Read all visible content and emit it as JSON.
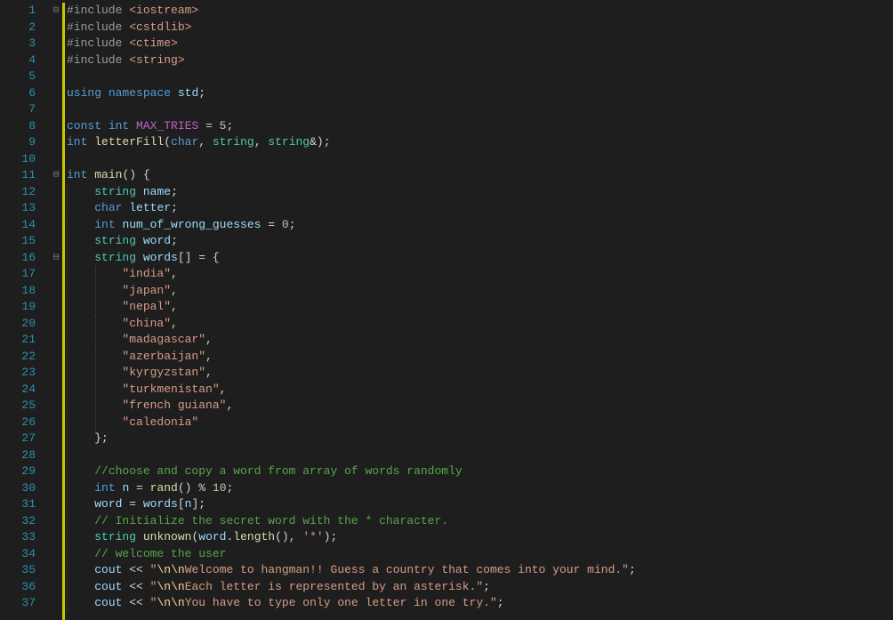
{
  "lines": [
    {
      "n": 1,
      "fold": "minus",
      "tokens": [
        [
          "preproc",
          "#include "
        ],
        [
          "string",
          "<iostream>"
        ]
      ]
    },
    {
      "n": 2,
      "fold": "",
      "tokens": [
        [
          "preproc",
          "#include "
        ],
        [
          "string",
          "<cstdlib>"
        ]
      ]
    },
    {
      "n": 3,
      "fold": "",
      "tokens": [
        [
          "preproc",
          "#include "
        ],
        [
          "string",
          "<ctime>"
        ]
      ]
    },
    {
      "n": 4,
      "fold": "",
      "tokens": [
        [
          "preproc",
          "#include "
        ],
        [
          "string",
          "<string>"
        ]
      ]
    },
    {
      "n": 5,
      "fold": "",
      "tokens": []
    },
    {
      "n": 6,
      "fold": "",
      "tokens": [
        [
          "keyword",
          "using"
        ],
        [
          "plain",
          " "
        ],
        [
          "keyword",
          "namespace"
        ],
        [
          "plain",
          " "
        ],
        [
          "var",
          "std"
        ],
        [
          "plain",
          ";"
        ]
      ]
    },
    {
      "n": 7,
      "fold": "",
      "tokens": []
    },
    {
      "n": 8,
      "fold": "",
      "tokens": [
        [
          "keyword",
          "const"
        ],
        [
          "plain",
          " "
        ],
        [
          "type",
          "int"
        ],
        [
          "plain",
          " "
        ],
        [
          "macro",
          "MAX_TRIES"
        ],
        [
          "plain",
          " = "
        ],
        [
          "num",
          "5"
        ],
        [
          "plain",
          ";"
        ]
      ]
    },
    {
      "n": 9,
      "fold": "",
      "tokens": [
        [
          "type",
          "int"
        ],
        [
          "plain",
          " "
        ],
        [
          "ident",
          "letterFill"
        ],
        [
          "plain",
          "("
        ],
        [
          "type",
          "char"
        ],
        [
          "plain",
          ", "
        ],
        [
          "class",
          "string"
        ],
        [
          "plain",
          ", "
        ],
        [
          "class",
          "string"
        ],
        [
          "plain",
          "&);"
        ]
      ]
    },
    {
      "n": 10,
      "fold": "",
      "tokens": []
    },
    {
      "n": 11,
      "fold": "minus",
      "tokens": [
        [
          "type",
          "int"
        ],
        [
          "plain",
          " "
        ],
        [
          "ident",
          "main"
        ],
        [
          "plain",
          "() {"
        ]
      ]
    },
    {
      "n": 12,
      "fold": "",
      "indent": 1,
      "tokens": [
        [
          "plain",
          "    "
        ],
        [
          "class",
          "string"
        ],
        [
          "plain",
          " "
        ],
        [
          "var",
          "name"
        ],
        [
          "plain",
          ";"
        ]
      ]
    },
    {
      "n": 13,
      "fold": "",
      "indent": 1,
      "tokens": [
        [
          "plain",
          "    "
        ],
        [
          "type",
          "char"
        ],
        [
          "plain",
          " "
        ],
        [
          "var",
          "letter"
        ],
        [
          "plain",
          ";"
        ]
      ]
    },
    {
      "n": 14,
      "fold": "",
      "indent": 1,
      "tokens": [
        [
          "plain",
          "    "
        ],
        [
          "type",
          "int"
        ],
        [
          "plain",
          " "
        ],
        [
          "var",
          "num_of_wrong_guesses"
        ],
        [
          "plain",
          " = "
        ],
        [
          "num",
          "0"
        ],
        [
          "plain",
          ";"
        ]
      ]
    },
    {
      "n": 15,
      "fold": "",
      "indent": 1,
      "tokens": [
        [
          "plain",
          "    "
        ],
        [
          "class",
          "string"
        ],
        [
          "plain",
          " "
        ],
        [
          "var",
          "word"
        ],
        [
          "plain",
          ";"
        ]
      ]
    },
    {
      "n": 16,
      "fold": "minus",
      "indent": 1,
      "tokens": [
        [
          "plain",
          "    "
        ],
        [
          "class",
          "string"
        ],
        [
          "plain",
          " "
        ],
        [
          "var",
          "words"
        ],
        [
          "plain",
          "[] = {"
        ]
      ]
    },
    {
      "n": 17,
      "fold": "",
      "indent": 2,
      "tokens": [
        [
          "plain",
          "        "
        ],
        [
          "string",
          "\"india\""
        ],
        [
          "plain",
          ","
        ]
      ]
    },
    {
      "n": 18,
      "fold": "",
      "indent": 2,
      "tokens": [
        [
          "plain",
          "        "
        ],
        [
          "string",
          "\"japan\""
        ],
        [
          "plain",
          ","
        ]
      ]
    },
    {
      "n": 19,
      "fold": "",
      "indent": 2,
      "tokens": [
        [
          "plain",
          "        "
        ],
        [
          "string",
          "\"nepal\""
        ],
        [
          "plain",
          ","
        ]
      ]
    },
    {
      "n": 20,
      "fold": "",
      "indent": 2,
      "tokens": [
        [
          "plain",
          "        "
        ],
        [
          "string",
          "\"china\""
        ],
        [
          "plain",
          ","
        ]
      ]
    },
    {
      "n": 21,
      "fold": "",
      "indent": 2,
      "tokens": [
        [
          "plain",
          "        "
        ],
        [
          "string",
          "\"madagascar\""
        ],
        [
          "plain",
          ","
        ]
      ]
    },
    {
      "n": 22,
      "fold": "",
      "indent": 2,
      "tokens": [
        [
          "plain",
          "        "
        ],
        [
          "string",
          "\"azerbaijan\""
        ],
        [
          "plain",
          ","
        ]
      ]
    },
    {
      "n": 23,
      "fold": "",
      "indent": 2,
      "tokens": [
        [
          "plain",
          "        "
        ],
        [
          "string",
          "\"kyrgyzstan\""
        ],
        [
          "plain",
          ","
        ]
      ]
    },
    {
      "n": 24,
      "fold": "",
      "indent": 2,
      "tokens": [
        [
          "plain",
          "        "
        ],
        [
          "string",
          "\"turkmenistan\""
        ],
        [
          "plain",
          ","
        ]
      ]
    },
    {
      "n": 25,
      "fold": "",
      "indent": 2,
      "tokens": [
        [
          "plain",
          "        "
        ],
        [
          "string",
          "\"french guiana\""
        ],
        [
          "plain",
          ","
        ]
      ]
    },
    {
      "n": 26,
      "fold": "",
      "indent": 2,
      "tokens": [
        [
          "plain",
          "        "
        ],
        [
          "string",
          "\"caledonia\""
        ]
      ]
    },
    {
      "n": 27,
      "fold": "",
      "indent": 1,
      "tokens": [
        [
          "plain",
          "    };"
        ]
      ]
    },
    {
      "n": 28,
      "fold": "",
      "indent": 1,
      "tokens": []
    },
    {
      "n": 29,
      "fold": "",
      "indent": 1,
      "tokens": [
        [
          "plain",
          "    "
        ],
        [
          "comment",
          "//choose and copy a word from array of words randomly"
        ]
      ]
    },
    {
      "n": 30,
      "fold": "",
      "indent": 1,
      "tokens": [
        [
          "plain",
          "    "
        ],
        [
          "type",
          "int"
        ],
        [
          "plain",
          " "
        ],
        [
          "var",
          "n"
        ],
        [
          "plain",
          " = "
        ],
        [
          "ident",
          "rand"
        ],
        [
          "plain",
          "() % "
        ],
        [
          "num",
          "10"
        ],
        [
          "plain",
          ";"
        ]
      ]
    },
    {
      "n": 31,
      "fold": "",
      "indent": 1,
      "tokens": [
        [
          "plain",
          "    "
        ],
        [
          "var",
          "word"
        ],
        [
          "plain",
          " = "
        ],
        [
          "var",
          "words"
        ],
        [
          "plain",
          "["
        ],
        [
          "var",
          "n"
        ],
        [
          "plain",
          "];"
        ]
      ]
    },
    {
      "n": 32,
      "fold": "",
      "indent": 1,
      "tokens": [
        [
          "plain",
          "    "
        ],
        [
          "comment",
          "// Initialize the secret word with the * character."
        ]
      ]
    },
    {
      "n": 33,
      "fold": "",
      "indent": 1,
      "tokens": [
        [
          "plain",
          "    "
        ],
        [
          "class",
          "string"
        ],
        [
          "plain",
          " "
        ],
        [
          "ident",
          "unknown"
        ],
        [
          "plain",
          "("
        ],
        [
          "var",
          "word"
        ],
        [
          "plain",
          "."
        ],
        [
          "ident",
          "length"
        ],
        [
          "plain",
          "(), "
        ],
        [
          "string",
          "'*'"
        ],
        [
          "plain",
          ");"
        ]
      ]
    },
    {
      "n": 34,
      "fold": "",
      "indent": 1,
      "tokens": [
        [
          "plain",
          "    "
        ],
        [
          "comment",
          "// welcome the user"
        ]
      ]
    },
    {
      "n": 35,
      "fold": "",
      "indent": 1,
      "tokens": [
        [
          "plain",
          "    "
        ],
        [
          "var",
          "cout"
        ],
        [
          "plain",
          " << "
        ],
        [
          "string",
          "\""
        ],
        [
          "esc",
          "\\n\\n"
        ],
        [
          "string",
          "Welcome to hangman!! Guess a country that comes into your mind.\""
        ],
        [
          "plain",
          ";"
        ]
      ]
    },
    {
      "n": 36,
      "fold": "",
      "indent": 1,
      "tokens": [
        [
          "plain",
          "    "
        ],
        [
          "var",
          "cout"
        ],
        [
          "plain",
          " << "
        ],
        [
          "string",
          "\""
        ],
        [
          "esc",
          "\\n\\n"
        ],
        [
          "string",
          "Each letter is represented by an asterisk.\""
        ],
        [
          "plain",
          ";"
        ]
      ]
    },
    {
      "n": 37,
      "fold": "",
      "indent": 1,
      "tokens": [
        [
          "plain",
          "    "
        ],
        [
          "var",
          "cout"
        ],
        [
          "plain",
          " << "
        ],
        [
          "string",
          "\""
        ],
        [
          "esc",
          "\\n\\n"
        ],
        [
          "string",
          "You have to type only one letter in one try.\""
        ],
        [
          "plain",
          ";"
        ]
      ]
    }
  ],
  "fold_glyphs": {
    "minus": "⊟",
    "plus": "⊞"
  }
}
